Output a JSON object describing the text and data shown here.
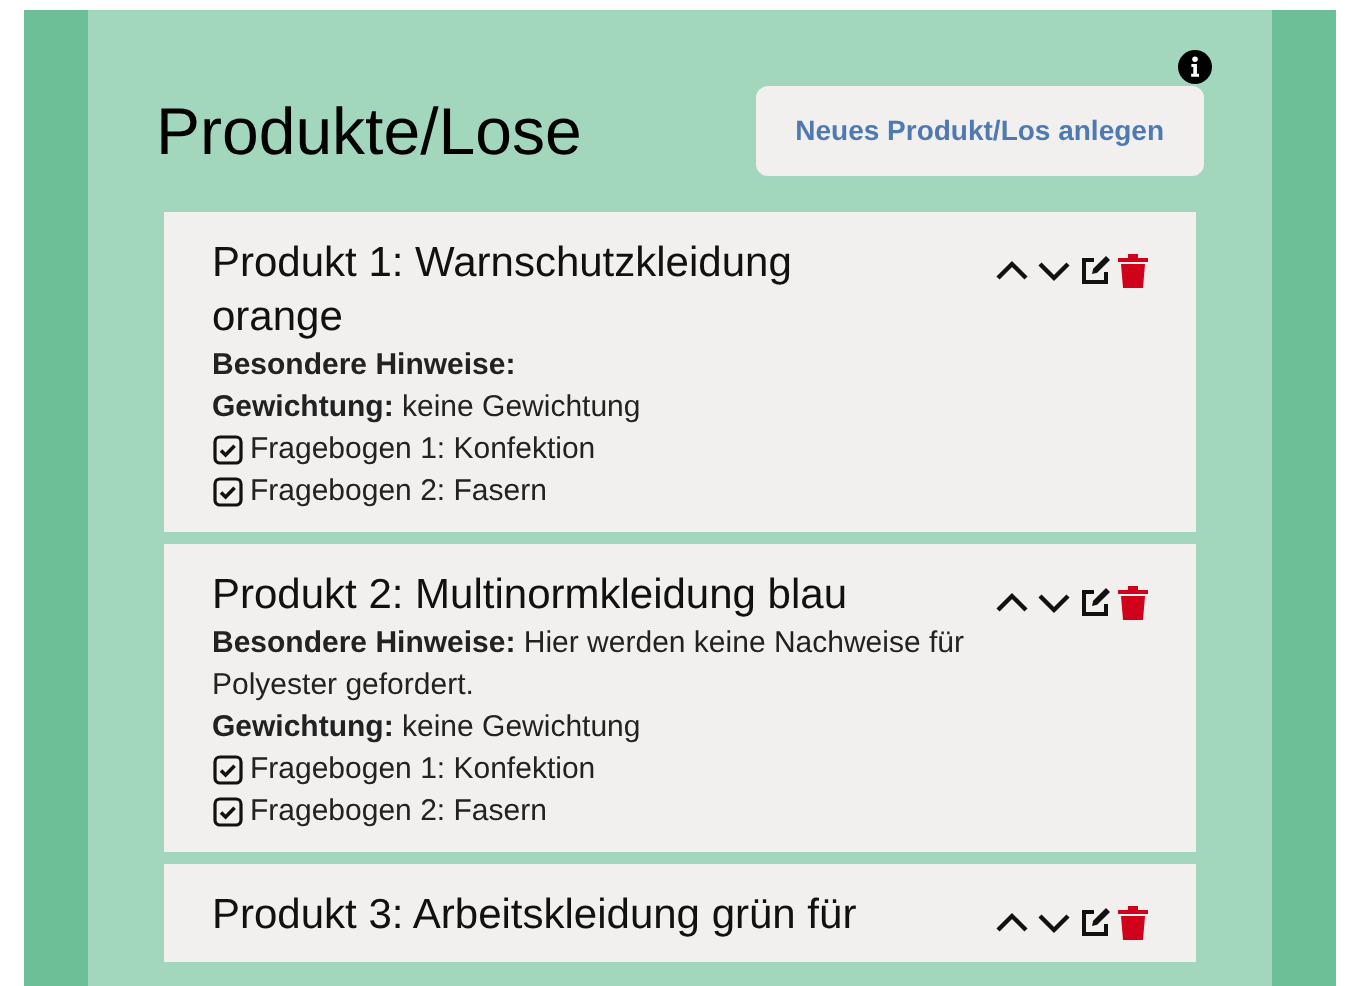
{
  "page": {
    "title": "Produkte/Lose",
    "new_button": "Neues Produkt/Los anlegen"
  },
  "products": [
    {
      "title": "Produkt 1: Warnschutzkleidung orange",
      "notes_label": "Besondere Hinweise:",
      "weighting_label": "Gewichtung:",
      "weighting": "keine Gewichtung",
      "questionnaires": [
        {
          "label": "Fragebogen 1: Konfektion",
          "checked": true
        },
        {
          "label": "Fragebogen 2: Fasern",
          "checked": true
        }
      ]
    },
    {
      "title": "Produkt 2: Multinormkleidung blau",
      "notes_label": "Besondere Hinweise:",
      "notes": "Hier werden keine Nachweise für Polyester gefordert.",
      "weighting_label": "Gewichtung:",
      "weighting": "keine Gewichtung",
      "questionnaires": [
        {
          "label": "Fragebogen 1: Konfektion",
          "checked": true
        },
        {
          "label": "Fragebogen 2: Fasern",
          "checked": true
        }
      ]
    },
    {
      "title": "Produkt 3: Arbeitskleidung grün für"
    }
  ]
}
